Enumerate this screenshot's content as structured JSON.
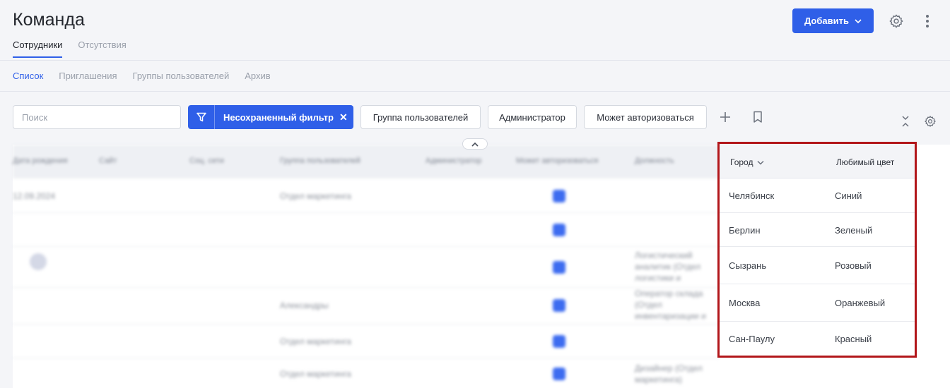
{
  "header": {
    "title": "Команда",
    "tabs": [
      {
        "label": "Сотрудники",
        "active": true
      },
      {
        "label": "Отсутствия",
        "active": false
      }
    ],
    "add_button": "Добавить",
    "icons": [
      "gear-icon",
      "kebab-menu-icon"
    ]
  },
  "subnav": {
    "items": [
      {
        "label": "Список",
        "active": true
      },
      {
        "label": "Приглашения",
        "active": false
      },
      {
        "label": "Группы пользователей",
        "active": false
      },
      {
        "label": "Архив",
        "active": false
      }
    ]
  },
  "toolbar": {
    "search_placeholder": "Поиск",
    "filter_label": "Несохраненный фильтр",
    "filter_close": "✕",
    "chips": [
      "Группа пользователей",
      "Администратор",
      "Может авторизоваться"
    ],
    "icons": [
      "plus-icon",
      "bookmark-icon",
      "collapse-icon",
      "settings-icon"
    ]
  },
  "blurred_table": {
    "headers": [
      "Дата рождения",
      "Сайт",
      "Соц. сети",
      "Группа пользователей",
      "Администратор",
      "Может авторизоваться",
      "Должность"
    ],
    "rows": [
      {
        "date": "12.09.2024",
        "group": "Отдел маркетинга",
        "position": ""
      },
      {
        "date": "",
        "group": "",
        "position": ""
      },
      {
        "date": "",
        "group": "",
        "position": "Логистический аналитик (Отдел логистики и"
      },
      {
        "date": "",
        "group": "Александры",
        "position": "Оператор склада (Отдел инвентаризации и"
      },
      {
        "date": "",
        "group": "Отдел маркетинга",
        "position": ""
      },
      {
        "date": "",
        "group": "Отдел маркетинга",
        "position": "Дизайнер (Отдел маркетинга)"
      }
    ]
  },
  "focused_table": {
    "headers": {
      "city": "Город",
      "color": "Любимый цвет"
    },
    "rows": [
      {
        "city": "Челябинск",
        "color": "Синий"
      },
      {
        "city": "Берлин",
        "color": "Зеленый"
      },
      {
        "city": "Сызрань",
        "color": "Розовый"
      },
      {
        "city": "Москва",
        "color": "Оранжевый"
      },
      {
        "city": "Сан-Паулу",
        "color": "Красный"
      }
    ]
  },
  "colors": {
    "accent": "#2f5fe8",
    "highlight_border": "#b2161a"
  }
}
